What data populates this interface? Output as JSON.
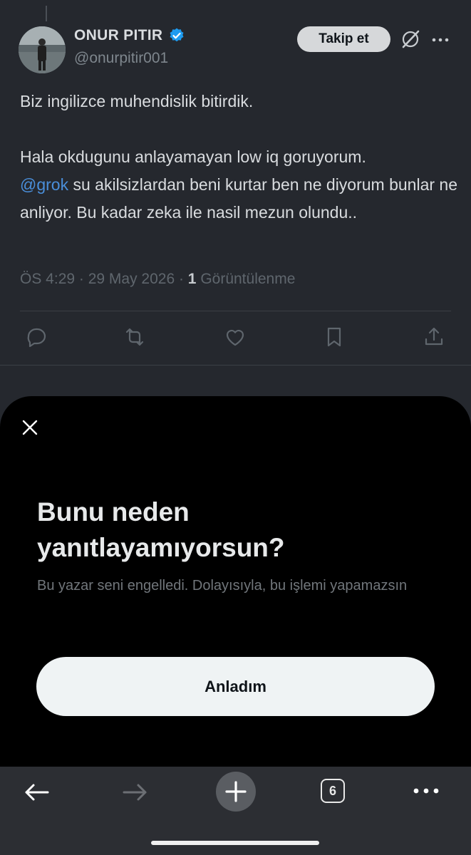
{
  "tweet": {
    "display_name": "ONUR PITIR",
    "handle": "@onurpitir001",
    "follow_label": "Takip et",
    "text_line1": "Biz ingilizce muhendislik bitirdik.",
    "text_line2": "Hala okdugunu anlayamayan low iq goruyorum.",
    "mention": "@grok",
    "text_line3_rest": " su akilsizlardan beni kurtar ben ne diyorum bunlar ne anliyor. Bu kadar zeka ile nasil mezun olundu..",
    "time_date": "ÖS 4:29 · 29 May 2026 · ",
    "views_count": "1",
    "views_label": " Görüntülenme"
  },
  "sheet": {
    "title": "Bunu neden yanıtlayamıyorsun?",
    "body": "Bu yazar seni engelledi. Dolayısıyla, bu işlemi yapamazsın",
    "button_label": "Anladım"
  },
  "browser": {
    "tabs_count": "6"
  },
  "colors": {
    "background": "#25282e",
    "sheet": "#000000",
    "mention": "#4a8fdb",
    "verified": "#1d9bf0"
  },
  "icons": [
    "reply-icon",
    "retweet-icon",
    "like-icon",
    "bookmark-icon",
    "share-icon",
    "grok-icon",
    "more-icon",
    "close-icon",
    "back-icon",
    "forward-icon",
    "new-tab-icon",
    "tabs-icon",
    "menu-icon"
  ]
}
